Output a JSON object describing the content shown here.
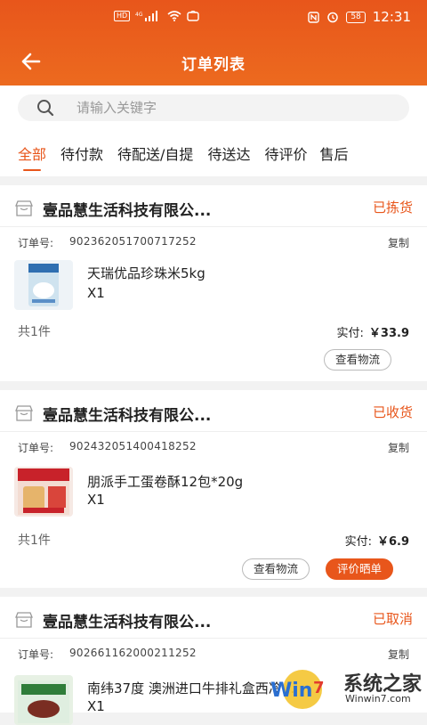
{
  "status_bar": {
    "left_icons": "HD ⁴⁶ ᵢₗₗ",
    "battery": "58",
    "time": "12:31"
  },
  "header": {
    "title": "订单列表"
  },
  "search": {
    "placeholder": "请输入关键字"
  },
  "tabs": [
    "全部",
    "待付款",
    "待配送/自提",
    "待送达",
    "待评价",
    "售后"
  ],
  "orders": [
    {
      "shop": "壹品慧生活科技有限公...",
      "status": "已拣货",
      "order_no_label": "订单号:",
      "order_no": "902362051700717252",
      "copy": "复制",
      "product": "天瑞优品珍珠米5kg",
      "qty": "X1",
      "total": "共1件",
      "paid_label": "实付:",
      "paid_amount": "￥33.9",
      "buttons": [
        "查看物流"
      ]
    },
    {
      "shop": "壹品慧生活科技有限公...",
      "status": "已收货",
      "order_no_label": "订单号:",
      "order_no": "902432051400418252",
      "copy": "复制",
      "product": "朋派手工蛋卷酥12包*20g",
      "qty": "X1",
      "total": "共1件",
      "paid_label": "实付:",
      "paid_amount": "￥6.9",
      "buttons": [
        "查看物流",
        "评价晒单"
      ]
    },
    {
      "shop": "壹品慧生活科技有限公...",
      "status": "已取消",
      "order_no_label": "订单号:",
      "order_no": "902661162000211252",
      "copy": "复制",
      "product": "南纬37度 澳洲进口牛排礼盒西冷...",
      "qty": "X1"
    }
  ],
  "watermark": {
    "text": "系统之家",
    "url": "Winwin7.com"
  },
  "colors": {
    "accent": "#e8561b",
    "background": "#f2f2f2"
  }
}
